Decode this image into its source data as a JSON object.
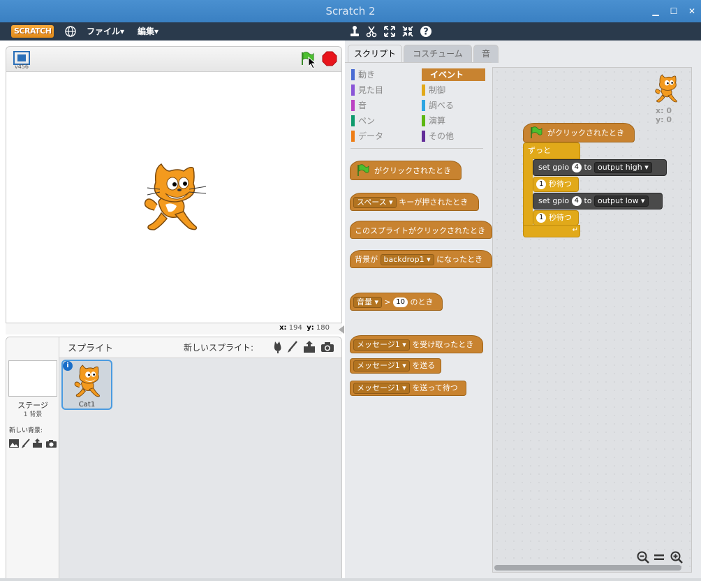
{
  "window": {
    "title": "Scratch 2",
    "minimize": "▁",
    "maximize": "☐",
    "close": "✕"
  },
  "menubar": {
    "logo": "SCRATCH",
    "file_menu": "ファイル▾",
    "edit_menu": "編集▾"
  },
  "stage": {
    "version": "v456",
    "coords_x_label": "x:",
    "coords_x": "194",
    "coords_y_label": "y:",
    "coords_y": "180"
  },
  "sprites": {
    "header": "スプライト",
    "new_sprite_label": "新しいスプライト:",
    "stage_label": "ステージ",
    "stage_count": "1 背景",
    "new_backdrop_label": "新しい背景:",
    "items": [
      {
        "name": "Cat1",
        "info": "i"
      }
    ]
  },
  "tabs": [
    {
      "label": "スクリプト"
    },
    {
      "label": "コスチューム"
    },
    {
      "label": "音"
    }
  ],
  "categories": [
    {
      "label": "動き",
      "color": "#4a6cd4"
    },
    {
      "label": "イベント",
      "color": "#c88330"
    },
    {
      "label": "見た目",
      "color": "#8a55d7"
    },
    {
      "label": "制御",
      "color": "#e1a91a"
    },
    {
      "label": "音",
      "color": "#bb42c3"
    },
    {
      "label": "調べる",
      "color": "#2ca5e2"
    },
    {
      "label": "ペン",
      "color": "#0e9a6c"
    },
    {
      "label": "演算",
      "color": "#5cb712"
    },
    {
      "label": "データ",
      "color": "#ee7d16"
    },
    {
      "label": "その他",
      "color": "#632d99"
    }
  ],
  "palette": {
    "flag_clicked": "がクリックされたとき",
    "key_dd": "スペース",
    "key_text": "キーが押されたとき",
    "sprite_clicked": "このスプライトがクリックされたとき",
    "backdrop_prefix": "背景が",
    "backdrop_dd": "backdrop1",
    "backdrop_suffix": "になったとき",
    "loudness_dd": "音量",
    "gt": ">",
    "loudness_val": "10",
    "when_suffix": "のとき",
    "msg_dd1": "メッセージ1",
    "receive_text": "を受け取ったとき",
    "msg_dd2": "メッセージ1",
    "send_text": "を送る",
    "msg_dd3": "メッセージ1",
    "send_wait_text": "を送って待つ"
  },
  "script": {
    "hat": "がクリックされたとき",
    "forever": "ずっと",
    "set1_prefix": "set",
    "set1_gpio": "gpio",
    "set1_pin": "4",
    "set1_to": "to",
    "set1_dd": "output high",
    "wait1_val": "1",
    "wait1_text": "秒待つ",
    "set2_prefix": "set",
    "set2_gpio": "gpio",
    "set2_pin": "4",
    "set2_to": "to",
    "set2_dd": "output low",
    "wait2_val": "1",
    "wait2_text": "秒待つ",
    "sprite_x": "x: 0",
    "sprite_y": "y: 0"
  }
}
